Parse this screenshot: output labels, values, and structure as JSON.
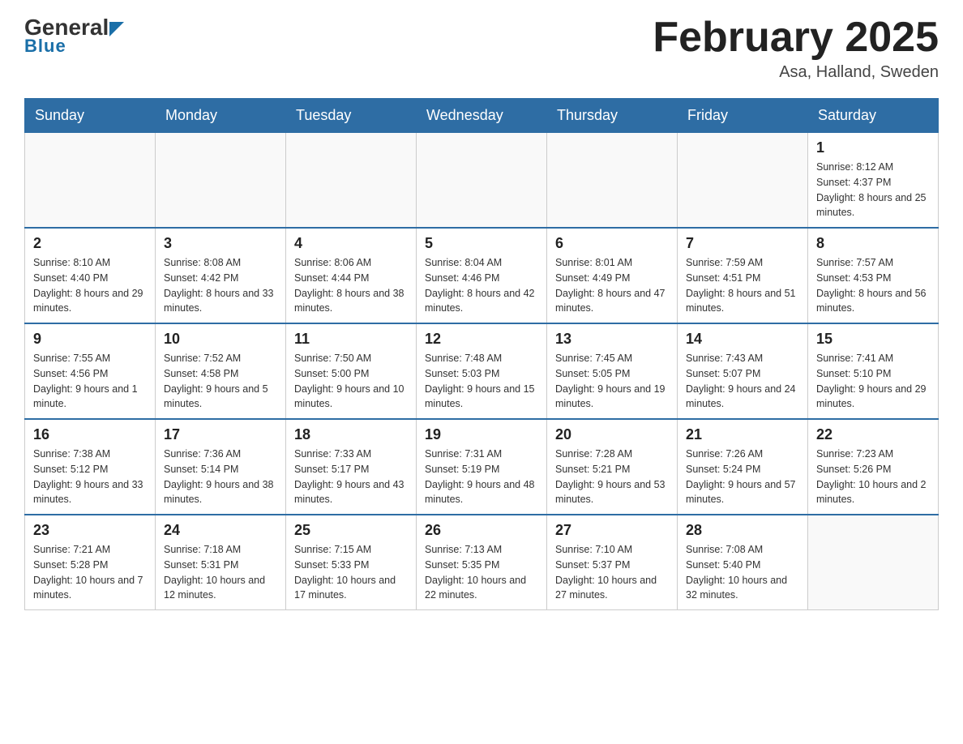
{
  "header": {
    "logo": {
      "general": "General",
      "blue": "Blue"
    },
    "title": "February 2025",
    "location": "Asa, Halland, Sweden"
  },
  "calendar": {
    "days_of_week": [
      "Sunday",
      "Monday",
      "Tuesday",
      "Wednesday",
      "Thursday",
      "Friday",
      "Saturday"
    ],
    "weeks": [
      [
        {
          "day": "",
          "info": ""
        },
        {
          "day": "",
          "info": ""
        },
        {
          "day": "",
          "info": ""
        },
        {
          "day": "",
          "info": ""
        },
        {
          "day": "",
          "info": ""
        },
        {
          "day": "",
          "info": ""
        },
        {
          "day": "1",
          "info": "Sunrise: 8:12 AM\nSunset: 4:37 PM\nDaylight: 8 hours and 25 minutes."
        }
      ],
      [
        {
          "day": "2",
          "info": "Sunrise: 8:10 AM\nSunset: 4:40 PM\nDaylight: 8 hours and 29 minutes."
        },
        {
          "day": "3",
          "info": "Sunrise: 8:08 AM\nSunset: 4:42 PM\nDaylight: 8 hours and 33 minutes."
        },
        {
          "day": "4",
          "info": "Sunrise: 8:06 AM\nSunset: 4:44 PM\nDaylight: 8 hours and 38 minutes."
        },
        {
          "day": "5",
          "info": "Sunrise: 8:04 AM\nSunset: 4:46 PM\nDaylight: 8 hours and 42 minutes."
        },
        {
          "day": "6",
          "info": "Sunrise: 8:01 AM\nSunset: 4:49 PM\nDaylight: 8 hours and 47 minutes."
        },
        {
          "day": "7",
          "info": "Sunrise: 7:59 AM\nSunset: 4:51 PM\nDaylight: 8 hours and 51 minutes."
        },
        {
          "day": "8",
          "info": "Sunrise: 7:57 AM\nSunset: 4:53 PM\nDaylight: 8 hours and 56 minutes."
        }
      ],
      [
        {
          "day": "9",
          "info": "Sunrise: 7:55 AM\nSunset: 4:56 PM\nDaylight: 9 hours and 1 minute."
        },
        {
          "day": "10",
          "info": "Sunrise: 7:52 AM\nSunset: 4:58 PM\nDaylight: 9 hours and 5 minutes."
        },
        {
          "day": "11",
          "info": "Sunrise: 7:50 AM\nSunset: 5:00 PM\nDaylight: 9 hours and 10 minutes."
        },
        {
          "day": "12",
          "info": "Sunrise: 7:48 AM\nSunset: 5:03 PM\nDaylight: 9 hours and 15 minutes."
        },
        {
          "day": "13",
          "info": "Sunrise: 7:45 AM\nSunset: 5:05 PM\nDaylight: 9 hours and 19 minutes."
        },
        {
          "day": "14",
          "info": "Sunrise: 7:43 AM\nSunset: 5:07 PM\nDaylight: 9 hours and 24 minutes."
        },
        {
          "day": "15",
          "info": "Sunrise: 7:41 AM\nSunset: 5:10 PM\nDaylight: 9 hours and 29 minutes."
        }
      ],
      [
        {
          "day": "16",
          "info": "Sunrise: 7:38 AM\nSunset: 5:12 PM\nDaylight: 9 hours and 33 minutes."
        },
        {
          "day": "17",
          "info": "Sunrise: 7:36 AM\nSunset: 5:14 PM\nDaylight: 9 hours and 38 minutes."
        },
        {
          "day": "18",
          "info": "Sunrise: 7:33 AM\nSunset: 5:17 PM\nDaylight: 9 hours and 43 minutes."
        },
        {
          "day": "19",
          "info": "Sunrise: 7:31 AM\nSunset: 5:19 PM\nDaylight: 9 hours and 48 minutes."
        },
        {
          "day": "20",
          "info": "Sunrise: 7:28 AM\nSunset: 5:21 PM\nDaylight: 9 hours and 53 minutes."
        },
        {
          "day": "21",
          "info": "Sunrise: 7:26 AM\nSunset: 5:24 PM\nDaylight: 9 hours and 57 minutes."
        },
        {
          "day": "22",
          "info": "Sunrise: 7:23 AM\nSunset: 5:26 PM\nDaylight: 10 hours and 2 minutes."
        }
      ],
      [
        {
          "day": "23",
          "info": "Sunrise: 7:21 AM\nSunset: 5:28 PM\nDaylight: 10 hours and 7 minutes."
        },
        {
          "day": "24",
          "info": "Sunrise: 7:18 AM\nSunset: 5:31 PM\nDaylight: 10 hours and 12 minutes."
        },
        {
          "day": "25",
          "info": "Sunrise: 7:15 AM\nSunset: 5:33 PM\nDaylight: 10 hours and 17 minutes."
        },
        {
          "day": "26",
          "info": "Sunrise: 7:13 AM\nSunset: 5:35 PM\nDaylight: 10 hours and 22 minutes."
        },
        {
          "day": "27",
          "info": "Sunrise: 7:10 AM\nSunset: 5:37 PM\nDaylight: 10 hours and 27 minutes."
        },
        {
          "day": "28",
          "info": "Sunrise: 7:08 AM\nSunset: 5:40 PM\nDaylight: 10 hours and 32 minutes."
        },
        {
          "day": "",
          "info": ""
        }
      ]
    ]
  }
}
